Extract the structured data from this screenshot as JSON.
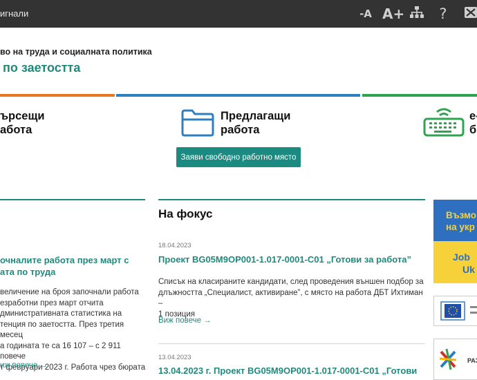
{
  "topbar": {
    "signals_label": "игнали",
    "decrease_font_label": "-A",
    "increase_font_label": "A+",
    "help_label": "?"
  },
  "header": {
    "ministry": "во на труда и социалната политика",
    "agency": "по заетостта"
  },
  "colors": {
    "topbar": "#333333",
    "accent": "#1f8a7c",
    "stripe_orange": "#e87722",
    "stripe_blue": "#2e7fc0",
    "stripe_green": "#2ea44f"
  },
  "cards": {
    "job_seekers": {
      "line1": "ърсещи",
      "line2": "абота"
    },
    "employers": {
      "line1": "Предлагащи",
      "line2": "работа",
      "cta": "Заяви свободно работно място",
      "icon": "folder-icon"
    },
    "eservices": {
      "line1": "е-",
      "line2": "б",
      "icon": "keyboard-icon"
    }
  },
  "left_news": {
    "title_line1": "очналите работа през март с",
    "title_line2": "ата по труда",
    "body": [
      "величение на броя започнали работа",
      "езработни през март отчита",
      "дминистративната статистика на",
      "тенция по заетостта. През третия месец",
      "а годината те са 16 107 – с 2 911 повече",
      "т февруари 2023 г. Работа чрез бюрата"
    ],
    "more": "иж повече →"
  },
  "focus": {
    "heading": "На фокус",
    "items": [
      {
        "date": "18.04.2023",
        "title": "Проект BG05M9OP001-1.017-0001-C01 „Готови за работа”",
        "body": [
          "Списък на класираните кандидати, след проведения външен подбор за",
          "длъжността „Специалист, активиране”, с място на работа ДБТ Ихтиман –",
          "1 позиция"
        ],
        "more": "Виж повече →"
      },
      {
        "date": "13.04.2023",
        "title": "13.04.2023 г. Проект BG05M9OP001-1.017-0001-C01 „Готови"
      }
    ]
  },
  "banners": {
    "ukraine": {
      "line1": "Възмо",
      "line2": "на укр",
      "line3": "Job",
      "line4": "Uk"
    },
    "eu": {
      "label": "EU"
    },
    "third": {
      "label": "РАЗ"
    }
  }
}
